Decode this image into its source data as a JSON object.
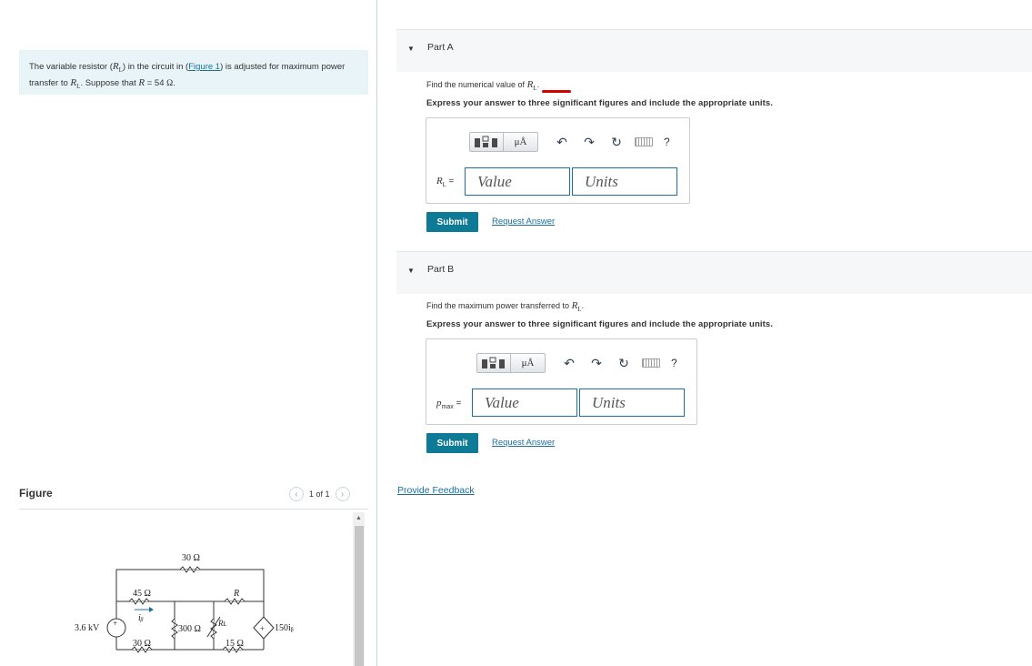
{
  "problem": {
    "text_1": "The variable resistor (",
    "var_rl": "R",
    "var_rl_sub": "L",
    "text_2": ") in the circuit in (",
    "figure_link": "Figure 1",
    "text_3": ") is adjusted for maximum power transfer to ",
    "text_4": ". Suppose that ",
    "var_r": "R",
    "text_5": " = 54 ",
    "unit_ohm": "Ω",
    "text_6": "."
  },
  "figure": {
    "label": "Figure",
    "pager_text": "1 of 1",
    "circuit": {
      "top_resistor": "30 Ω",
      "r45": "45 Ω",
      "r_label": "R",
      "source": "3.6 kV",
      "current_label": "iᵦ",
      "r300": "300 Ω",
      "rl_label": "Rʟ",
      "dep_source": "150iᵦ",
      "r30_bottom": "30 Ω",
      "r15": "15 Ω",
      "plus": "+"
    }
  },
  "parts": [
    {
      "title": "Part A",
      "prompt": "Find the numerical value of ",
      "prompt_var": "R",
      "prompt_sub": "L",
      "prompt_end": ".",
      "instruction": "Express your answer to three significant figures and include the appropriate units.",
      "field_var": "R",
      "field_sub": "L",
      "field_eq": " =",
      "value_placeholder": "Value",
      "units_placeholder": "Units",
      "submit": "Submit",
      "request": "Request Answer"
    },
    {
      "title": "Part B",
      "prompt": "Find the maximum power transferred to ",
      "prompt_var": "R",
      "prompt_sub": "L",
      "prompt_end": ".",
      "instruction": "Express your answer to three significant figures and include the appropriate units.",
      "field_var": "p",
      "field_sub": "max",
      "field_eq": " =",
      "value_placeholder": "Value",
      "units_placeholder": "Units",
      "submit": "Submit",
      "request": "Request Answer"
    }
  ],
  "toolbar": {
    "mu_label": "μÅ",
    "help": "?"
  },
  "feedback": "Provide Feedback",
  "colors": {
    "problem_bg": "#e8f4f7",
    "accent_teal": "#0f7a96",
    "link_blue": "#1a6fa0",
    "spellcheck_red": "#d40000"
  }
}
